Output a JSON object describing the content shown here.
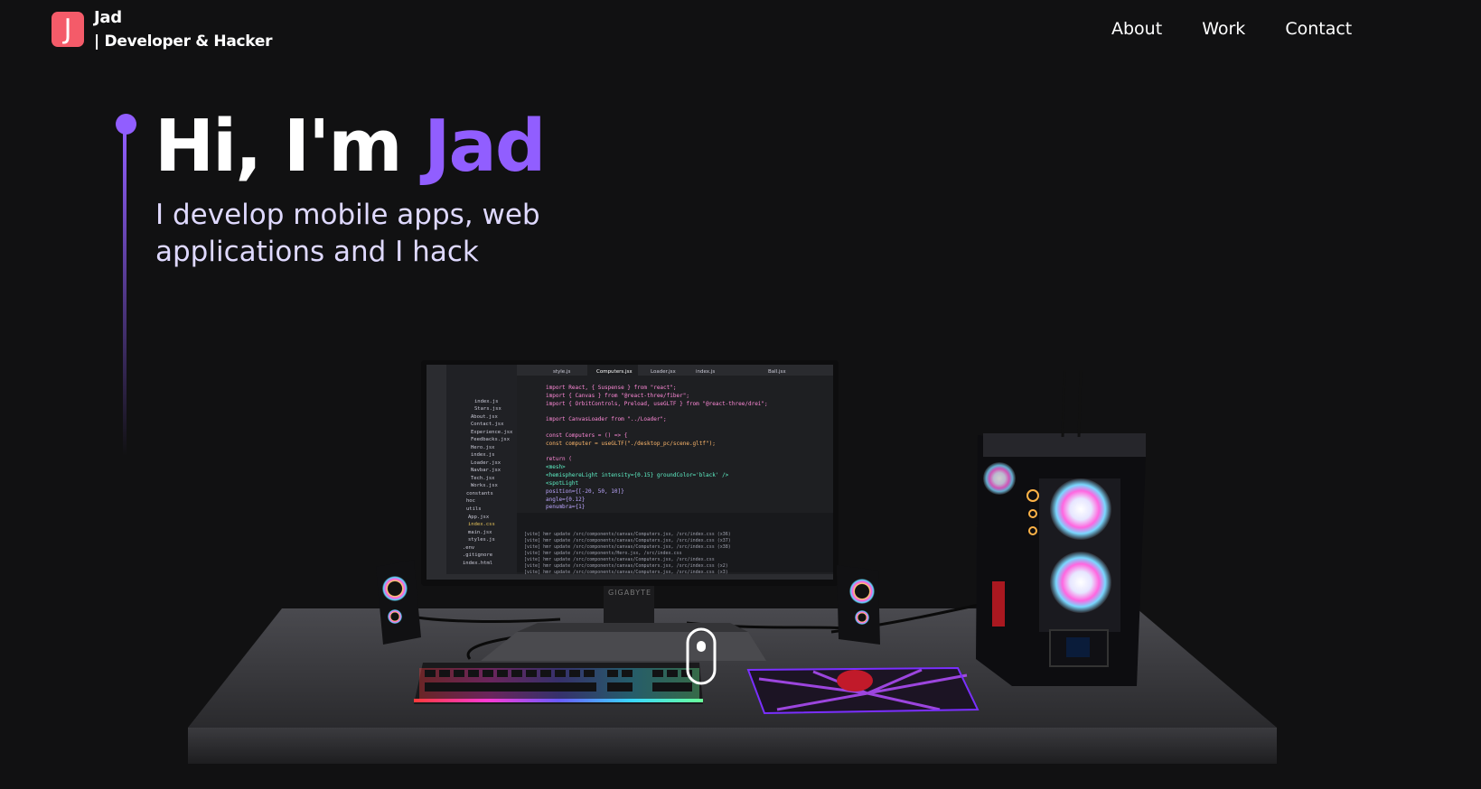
{
  "nav": {
    "logo_letter": "J",
    "brand_name": "Jad",
    "brand_sub": "| Developer & Hacker",
    "links": [
      "About",
      "Work",
      "Contact"
    ]
  },
  "hero": {
    "title_prefix": "Hi, I'm ",
    "title_name": "Jad",
    "subtitle": "I develop mobile apps, web applications and I hack"
  },
  "scene": {
    "monitor_brand": "GIGABYTE",
    "editor_tabs": [
      "style.js",
      "Computers.jsx",
      "Loader.jsx",
      "index.js",
      "Ball.jsx"
    ],
    "code_lines": [
      "import React, { Suspense } from \"react\";",
      "import { Canvas } from \"@react-three/fiber\";",
      "import { OrbitControls, Preload, useGLTF } from \"@react-three/drei\";",
      "",
      "import CanvasLoader from \"../Loader\";",
      "",
      "const Computers = () => {",
      "  const computer = useGLTF(\"./desktop_pc/scene.gltf\");",
      "",
      "  return (",
      "    <mesh>",
      "      <hemisphereLight intensity={0.15} groundColor='black' />",
      "      <spotLight",
      "        position={[-20, 50, 10]}",
      "        angle={0.12}",
      "        penumbra={1}"
    ],
    "file_list": [
      "index.js",
      "Stars.jsx",
      "About.jsx",
      "Contact.jsx",
      "Experience.jsx",
      "Feedbacks.jsx",
      "Hero.jsx",
      "index.js",
      "Loader.jsx",
      "Navbar.jsx",
      "Tech.jsx",
      "Works.jsx",
      "constants",
      "hoc",
      "utils",
      "App.jsx",
      "index.css",
      "main.jsx",
      "styles.js",
      ".env",
      ".gitignore",
      "index.html"
    ],
    "terminal_lines": [
      "[vite] hmr update /src/components/canvas/Computers.jsx, /src/index.css (x36)",
      "[vite] hmr update /src/components/canvas/Computers.jsx, /src/index.css (x37)",
      "[vite] hmr update /src/components/canvas/Computers.jsx, /src/index.css (x38)",
      "[vite] hmr update /src/components/Hero.jsx, /src/index.css",
      "[vite] hmr update /src/components/canvas/Computers.jsx, /src/index.css",
      "[vite] hmr update /src/components/canvas/Computers.jsx, /src/index.css (x2)",
      "[vite] hmr update /src/components/canvas/Computers.jsx, /src/index.css (x3)"
    ]
  }
}
